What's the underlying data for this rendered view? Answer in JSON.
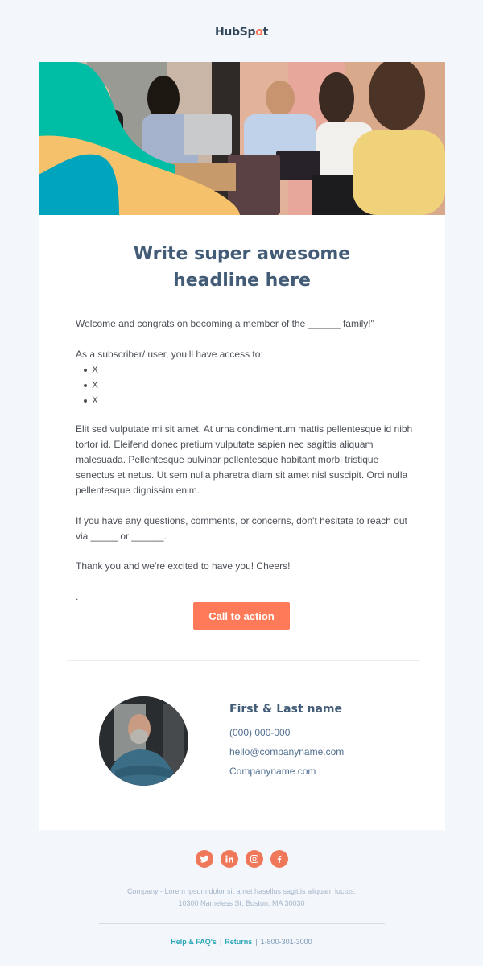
{
  "brand": {
    "logo_text_a": "HubSp",
    "logo_text_b": "o",
    "logo_text_c": "t",
    "accent": "#ff7a59",
    "heading_color": "#425b76",
    "link_color": "#2ba6b8"
  },
  "hero": {
    "alt": "Team collaborating with laptops"
  },
  "content": {
    "headline_line1": "Write super awesome",
    "headline_line2": "headline here",
    "welcome": "Welcome and congrats on becoming a member of the ______ family!\"",
    "access_intro": "As a subscriber/ user, you’ll have access to:",
    "bullets": [
      "X",
      "X",
      "X"
    ],
    "lorem": "Elit sed vulputate mi sit amet. At urna condimentum mattis pellentesque id nibh tortor id. Eleifend donec pretium vulputate sapien nec sagittis aliquam malesuada. Pellentesque pulvinar pellentesque habitant morbi tristique senectus et netus. Ut sem nulla pharetra diam sit amet nisl suscipit. Orci nulla pellentesque dignissim enim.",
    "questions": "If you have any questions, comments, or concerns, don't hesitate to reach out via _____ or ______.",
    "thanks": "Thank you and we're excited to have you! Cheers!",
    "stray_dot": ".",
    "cta_label": "Call to action"
  },
  "signature": {
    "name": "First & Last name",
    "phone": "(000) 000-000",
    "email": "hello@companyname.com",
    "website": "Companyname.com"
  },
  "social": [
    {
      "name": "twitter",
      "icon": "twitter-icon"
    },
    {
      "name": "linkedin",
      "icon": "linkedin-icon"
    },
    {
      "name": "instagram",
      "icon": "instagram-icon"
    },
    {
      "name": "facebook",
      "icon": "facebook-icon"
    }
  ],
  "footer": {
    "company_line": "Company - Lorem Ipsum dolor sit amet hasellus sagittis aliquam luctus.",
    "address": "10300 Nameless St, Boston, MA 30030",
    "help_link": "Help & FAQ's",
    "returns_link": "Returns",
    "separator": "|",
    "phone": "1-800-301-3000"
  }
}
